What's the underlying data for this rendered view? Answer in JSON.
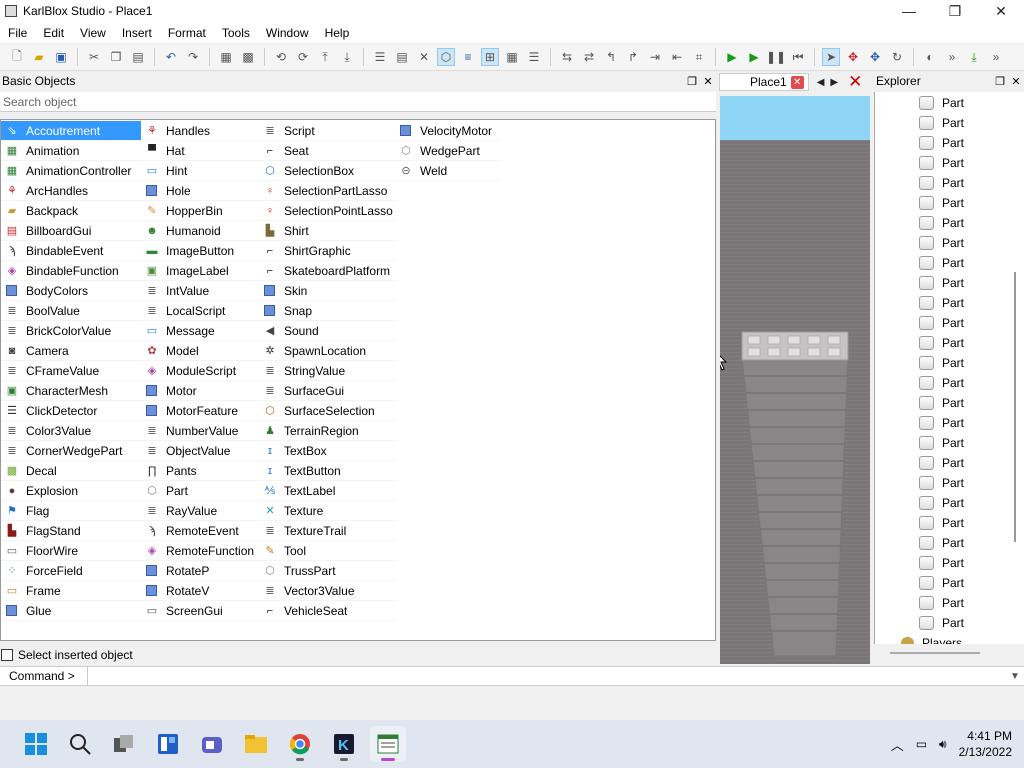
{
  "window": {
    "title": "KarlBlox Studio - Place1",
    "min": "—",
    "max": "❐",
    "close": "✕"
  },
  "menu": [
    "File",
    "Edit",
    "View",
    "Insert",
    "Format",
    "Tools",
    "Window",
    "Help"
  ],
  "basic_objects": {
    "title": "Basic Objects",
    "search_placeholder": "Search object",
    "select_inserted_label": "Select inserted object",
    "selected": "Accoutrement",
    "columns": [
      [
        {
          "label": "Accoutrement",
          "icon": "accoutrement-icon",
          "glyph": "⇘",
          "color": "#fff"
        },
        {
          "label": "Animation",
          "icon": "animation-icon",
          "glyph": "▦",
          "color": "#2e7d32"
        },
        {
          "label": "AnimationController",
          "icon": "animation-controller-icon",
          "glyph": "▦",
          "color": "#2e7d32"
        },
        {
          "label": "ArcHandles",
          "icon": "arc-handles-icon",
          "glyph": "⚘",
          "color": "#c62828"
        },
        {
          "label": "Backpack",
          "icon": "backpack-icon",
          "glyph": "▰",
          "color": "#c99a3a"
        },
        {
          "label": "BillboardGui",
          "icon": "billboard-gui-icon",
          "glyph": "▤",
          "color": "#c62828"
        },
        {
          "label": "BindableEvent",
          "icon": "bindable-event-icon",
          "glyph": "ϡ",
          "color": "#333"
        },
        {
          "label": "BindableFunction",
          "icon": "bindable-function-icon",
          "glyph": "◈",
          "color": "#b03fb0"
        },
        {
          "label": "BodyColors",
          "icon": "body-colors-icon",
          "glyph": "sq",
          "color": "#6b8fd8"
        },
        {
          "label": "BoolValue",
          "icon": "bool-value-icon",
          "glyph": "≣",
          "color": "#666"
        },
        {
          "label": "BrickColorValue",
          "icon": "brickcolor-value-icon",
          "glyph": "≣",
          "color": "#666"
        },
        {
          "label": "Camera",
          "icon": "camera-icon",
          "glyph": "◙",
          "color": "#444"
        },
        {
          "label": "CFrameValue",
          "icon": "cframe-value-icon",
          "glyph": "≣",
          "color": "#666"
        },
        {
          "label": "CharacterMesh",
          "icon": "character-mesh-icon",
          "glyph": "▣",
          "color": "#2e7d32"
        },
        {
          "label": "ClickDetector",
          "icon": "click-detector-icon",
          "glyph": "☰",
          "color": "#333"
        },
        {
          "label": "Color3Value",
          "icon": "color3-value-icon",
          "glyph": "≣",
          "color": "#666"
        },
        {
          "label": "CornerWedgePart",
          "icon": "corner-wedge-part-icon",
          "glyph": "≣",
          "color": "#666"
        },
        {
          "label": "Decal",
          "icon": "decal-icon",
          "glyph": "▩",
          "color": "#6ea82e"
        },
        {
          "label": "Explosion",
          "icon": "explosion-icon",
          "glyph": "●",
          "color": "#5d4037"
        },
        {
          "label": "Flag",
          "icon": "flag-icon",
          "glyph": "⚑",
          "color": "#1e6fd0"
        },
        {
          "label": "FlagStand",
          "icon": "flag-stand-icon",
          "glyph": "▙",
          "color": "#8b1a1a"
        },
        {
          "label": "FloorWire",
          "icon": "floor-wire-icon",
          "glyph": "▭",
          "color": "#555"
        },
        {
          "label": "ForceField",
          "icon": "force-field-icon",
          "glyph": "⁘",
          "color": "#2e7d32"
        },
        {
          "label": "Frame",
          "icon": "frame-icon",
          "glyph": "▭",
          "color": "#c07a20"
        },
        {
          "label": "Glue",
          "icon": "glue-icon",
          "glyph": "sq",
          "color": "#6b8fd8"
        }
      ],
      [
        {
          "label": "Handles",
          "icon": "handles-icon",
          "glyph": "⚘",
          "color": "#c62828"
        },
        {
          "label": "Hat",
          "icon": "hat-icon",
          "glyph": "▀",
          "color": "#222"
        },
        {
          "label": "Hint",
          "icon": "hint-icon",
          "glyph": "▭",
          "color": "#1e6fd0"
        },
        {
          "label": "Hole",
          "icon": "hole-icon",
          "glyph": "sq",
          "color": "#6b8fd8"
        },
        {
          "label": "HopperBin",
          "icon": "hopperbin-icon",
          "glyph": "✎",
          "color": "#d08a3a"
        },
        {
          "label": "Humanoid",
          "icon": "humanoid-icon",
          "glyph": "☻",
          "color": "#2e7d32"
        },
        {
          "label": "ImageButton",
          "icon": "image-button-icon",
          "glyph": "▬",
          "color": "#2a8a3a"
        },
        {
          "label": "ImageLabel",
          "icon": "image-label-icon",
          "glyph": "▣",
          "color": "#4a8a3a"
        },
        {
          "label": "IntValue",
          "icon": "int-value-icon",
          "glyph": "≣",
          "color": "#666"
        },
        {
          "label": "LocalScript",
          "icon": "local-script-icon",
          "glyph": "≣",
          "color": "#666"
        },
        {
          "label": "Message",
          "icon": "message-icon",
          "glyph": "▭",
          "color": "#1e6fd0"
        },
        {
          "label": "Model",
          "icon": "model-icon",
          "glyph": "✿",
          "color": "#b04040"
        },
        {
          "label": "ModuleScript",
          "icon": "module-script-icon",
          "glyph": "◈",
          "color": "#b03fb0"
        },
        {
          "label": "Motor",
          "icon": "motor-icon",
          "glyph": "sq",
          "color": "#6b8fd8"
        },
        {
          "label": "MotorFeature",
          "icon": "motor-feature-icon",
          "glyph": "sq",
          "color": "#6b8fd8"
        },
        {
          "label": "NumberValue",
          "icon": "number-value-icon",
          "glyph": "≣",
          "color": "#666"
        },
        {
          "label": "ObjectValue",
          "icon": "object-value-icon",
          "glyph": "≣",
          "color": "#666"
        },
        {
          "label": "Pants",
          "icon": "pants-icon",
          "glyph": "∏",
          "color": "#222"
        },
        {
          "label": "Part",
          "icon": "part-icon",
          "glyph": "⬡",
          "color": "#888"
        },
        {
          "label": "RayValue",
          "icon": "ray-value-icon",
          "glyph": "≣",
          "color": "#666"
        },
        {
          "label": "RemoteEvent",
          "icon": "remote-event-icon",
          "glyph": "ϡ",
          "color": "#333"
        },
        {
          "label": "RemoteFunction",
          "icon": "remote-function-icon",
          "glyph": "◈",
          "color": "#b03fb0"
        },
        {
          "label": "RotateP",
          "icon": "rotatep-icon",
          "glyph": "sq",
          "color": "#6b8fd8"
        },
        {
          "label": "RotateV",
          "icon": "rotatev-icon",
          "glyph": "sq",
          "color": "#6b8fd8"
        },
        {
          "label": "ScreenGui",
          "icon": "screen-gui-icon",
          "glyph": "▭",
          "color": "#555"
        }
      ],
      [
        {
          "label": "Script",
          "icon": "script-icon",
          "glyph": "≣",
          "color": "#666"
        },
        {
          "label": "Seat",
          "icon": "seat-icon",
          "glyph": "⌐",
          "color": "#222"
        },
        {
          "label": "SelectionBox",
          "icon": "selection-box-icon",
          "glyph": "⬡",
          "color": "#1e6fd0"
        },
        {
          "label": "SelectionPartLasso",
          "icon": "selection-part-lasso-icon",
          "glyph": "♀",
          "color": "#c62828"
        },
        {
          "label": "SelectionPointLasso",
          "icon": "selection-point-lasso-icon",
          "glyph": "♀",
          "color": "#c62828"
        },
        {
          "label": "Shirt",
          "icon": "shirt-icon",
          "glyph": "▙",
          "color": "#7a6a3a"
        },
        {
          "label": "ShirtGraphic",
          "icon": "shirt-graphic-icon",
          "glyph": "⌐",
          "color": "#222"
        },
        {
          "label": "SkateboardPlatform",
          "icon": "skateboard-platform-icon",
          "glyph": "⌐",
          "color": "#222"
        },
        {
          "label": "Skin",
          "icon": "skin-icon",
          "glyph": "sq",
          "color": "#6b8fd8"
        },
        {
          "label": "Snap",
          "icon": "snap-icon",
          "glyph": "sq",
          "color": "#6b8fd8"
        },
        {
          "label": "Sound",
          "icon": "sound-icon",
          "glyph": "◀",
          "color": "#444"
        },
        {
          "label": "SpawnLocation",
          "icon": "spawn-location-icon",
          "glyph": "✲",
          "color": "#333"
        },
        {
          "label": "StringValue",
          "icon": "string-value-icon",
          "glyph": "≣",
          "color": "#666"
        },
        {
          "label": "SurfaceGui",
          "icon": "surface-gui-icon",
          "glyph": "≣",
          "color": "#666"
        },
        {
          "label": "SurfaceSelection",
          "icon": "surface-selection-icon",
          "glyph": "⬡",
          "color": "#c65a28"
        },
        {
          "label": "TerrainRegion",
          "icon": "terrain-region-icon",
          "glyph": "♟",
          "color": "#2e7d32"
        },
        {
          "label": "TextBox",
          "icon": "textbox-icon",
          "glyph": "ɪ",
          "color": "#1e6fd0"
        },
        {
          "label": "TextButton",
          "icon": "textbutton-icon",
          "glyph": "ɪ",
          "color": "#1e6fd0"
        },
        {
          "label": "TextLabel",
          "icon": "textlabel-icon",
          "glyph": "⅍",
          "color": "#1e6fd0"
        },
        {
          "label": "Texture",
          "icon": "texture-icon",
          "glyph": "✕",
          "color": "#1fa0a0"
        },
        {
          "label": "TextureTrail",
          "icon": "texture-trail-icon",
          "glyph": "≣",
          "color": "#666"
        },
        {
          "label": "Tool",
          "icon": "tool-icon",
          "glyph": "✎",
          "color": "#c07a20"
        },
        {
          "label": "TrussPart",
          "icon": "truss-part-icon",
          "glyph": "⬡",
          "color": "#888"
        },
        {
          "label": "Vector3Value",
          "icon": "vector3-value-icon",
          "glyph": "≣",
          "color": "#666"
        },
        {
          "label": "VehicleSeat",
          "icon": "vehicle-seat-icon",
          "glyph": "⌐",
          "color": "#222"
        }
      ],
      [
        {
          "label": "VelocityMotor",
          "icon": "velocity-motor-icon",
          "glyph": "sq",
          "color": "#6b8fd8"
        },
        {
          "label": "WedgePart",
          "icon": "wedge-part-icon",
          "glyph": "⬡",
          "color": "#888"
        },
        {
          "label": "Weld",
          "icon": "weld-icon",
          "glyph": "⊝",
          "color": "#555"
        }
      ]
    ]
  },
  "viewport": {
    "tab_label": "Place1"
  },
  "explorer": {
    "title": "Explorer",
    "items": [
      "Part",
      "Part",
      "Part",
      "Part",
      "Part",
      "Part",
      "Part",
      "Part",
      "Part",
      "Part",
      "Part",
      "Part",
      "Part",
      "Part",
      "Part",
      "Part",
      "Part",
      "Part",
      "Part",
      "Part",
      "Part",
      "Part",
      "Part",
      "Part",
      "Part",
      "Part",
      "Part"
    ],
    "last_item": "Players"
  },
  "command": {
    "label": "Command >",
    "value": ""
  },
  "taskbar": {
    "apps": [
      "windows-start-icon",
      "search-icon",
      "task-view-icon",
      "widgets-icon",
      "meet-icon",
      "file-explorer-icon",
      "chrome-icon",
      "karlblox-icon",
      "karlblox-studio-icon"
    ],
    "time": "4:41 PM",
    "date": "2/13/2022"
  }
}
